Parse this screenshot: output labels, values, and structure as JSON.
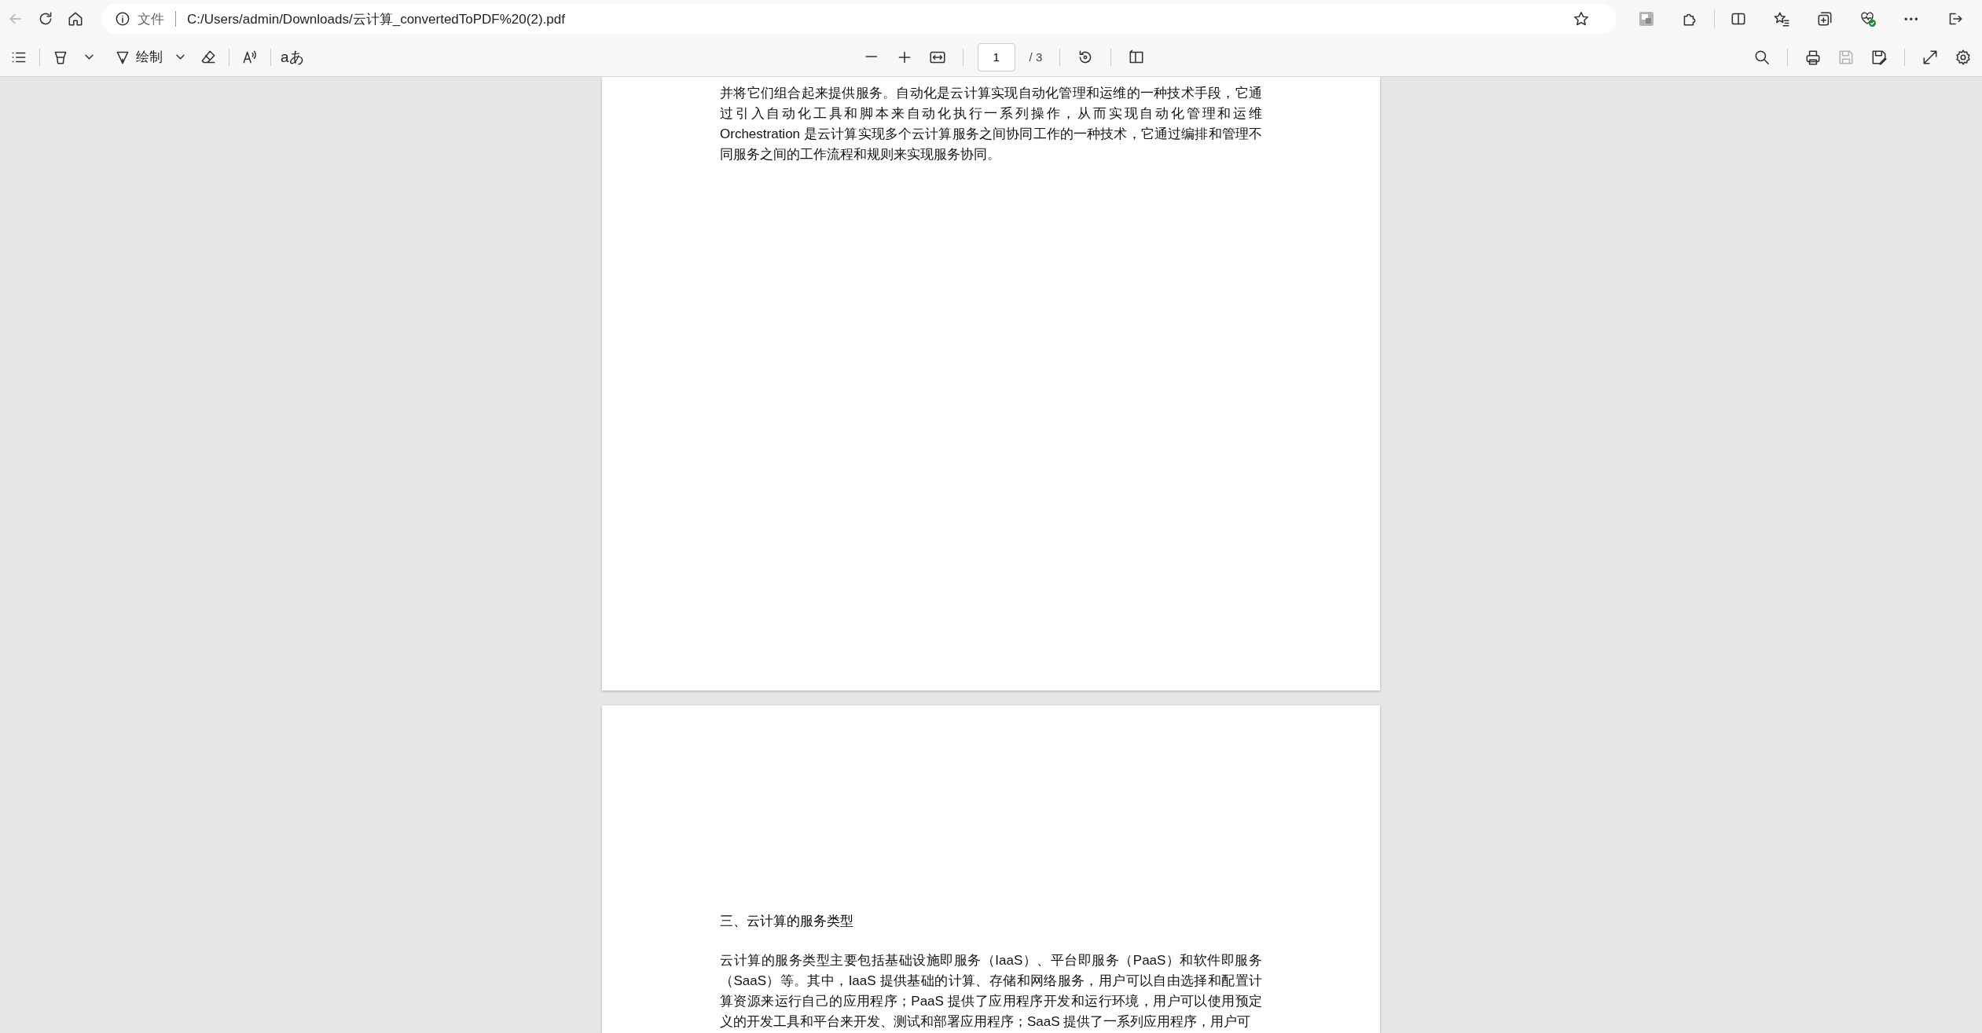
{
  "browser": {
    "back": {
      "disabled": true
    },
    "address": {
      "scheme_label": "文件",
      "url": "C:/Users/admin/Downloads/云计算_convertedToPDF%20(2).pdf"
    }
  },
  "pdf_toolbar": {
    "draw_label": "绘制",
    "text_option": "aあ",
    "page_number": "1",
    "page_count": "/ 3",
    "save": {
      "disabled": true
    }
  },
  "pages": [
    {
      "paragraphs": [
        "并将它们组合起来提供服务。自动化是云计算实现自动化管理和运维的一种技术手段，它通过引入自动化工具和脚本来自动化执行一系列操作，从而实现自动化管理和运维Orchestration 是云计算实现多个云计算服务之间协同工作的一种技术，它通过编排和管理不同服务之间的工作流程和规则来实现服务协同。"
      ]
    },
    {
      "heading": "三、云计算的服务类型",
      "paragraphs": [
        "云计算的服务类型主要包括基础设施即服务（IaaS）、平台即服务（PaaS）和软件即服务（SaaS）等。其中，IaaS 提供基础的计算、存储和网络服务，用户可以自由选择和配置计算资源来运行自己的应用程序；PaaS 提供了应用程序开发和运行环境，用户可以使用预定义的开发工具和平台来开发、测试和部署应用程序；SaaS 提供了一系列应用程序，用户可"
      ]
    }
  ]
}
